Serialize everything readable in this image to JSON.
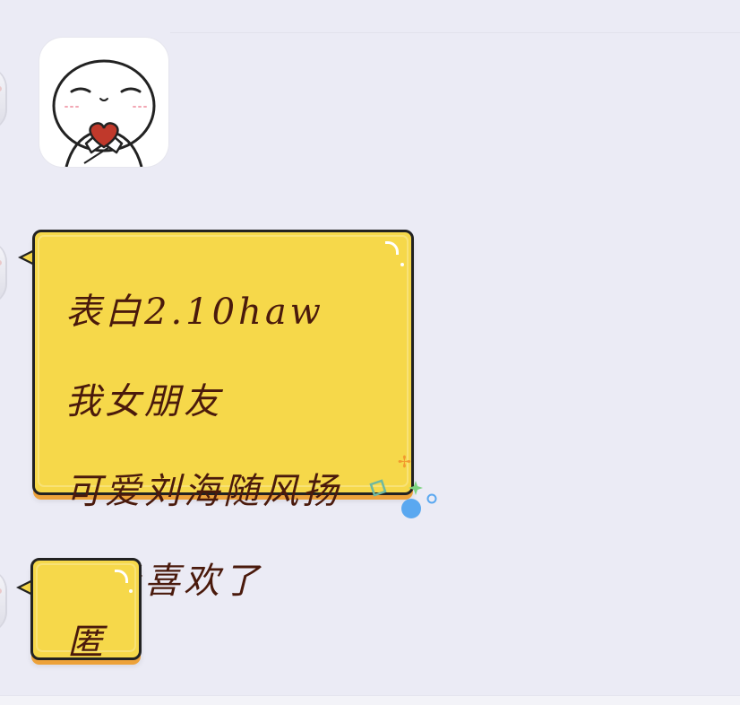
{
  "messages": [
    {
      "type": "sticker",
      "sticker_icon": "shy-heart-sticker-icon"
    },
    {
      "type": "text",
      "lines": [
        "表白2.10haw",
        "我女朋友",
        "可爱刘海随风扬",
        "超级喜欢了"
      ]
    },
    {
      "type": "text",
      "lines": [
        "匿"
      ]
    }
  ],
  "colors": {
    "background": "#ebebf5",
    "bubble_fill": "#f6d84a",
    "bubble_border": "#222222",
    "bubble_shadow": "#eda23a",
    "text": "#4a1a0c"
  }
}
